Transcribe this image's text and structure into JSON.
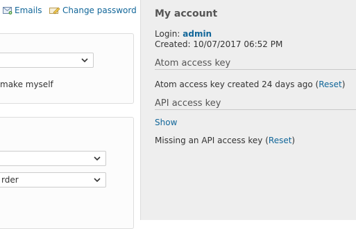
{
  "top_links": {
    "emails": "Emails",
    "change_password": "Change password"
  },
  "preferences": {
    "make_myself_text": "make myself",
    "select_3_value": "rder"
  },
  "sidebar": {
    "title": "My account",
    "login_label": "Login:",
    "login_value": "admin",
    "created_label": "Created:",
    "created_value": "10/07/2017 06:52 PM",
    "atom_title": "Atom access key",
    "atom_text": "Atom access key created 24 days ago",
    "atom_reset": "Reset",
    "api_title": "API access key",
    "api_show": "Show",
    "api_text": "Missing an API access key",
    "api_reset": "Reset"
  },
  "colors": {
    "link": "#116699",
    "sidebar_bg": "#eeeeee"
  }
}
